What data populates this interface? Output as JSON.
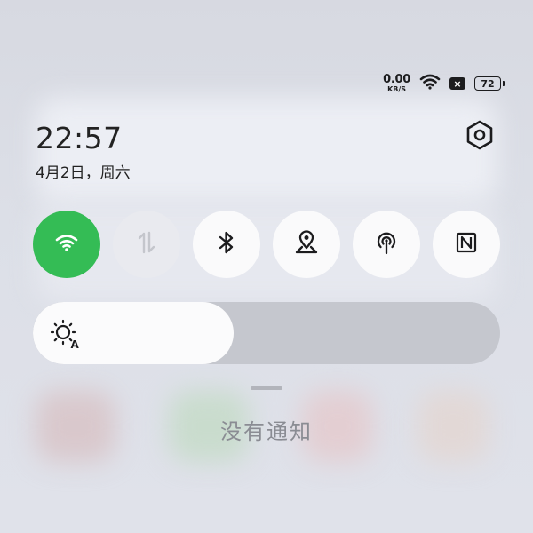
{
  "status_bar": {
    "net_speed_value": "0.00",
    "net_speed_unit": "KB/S",
    "battery_level": "72"
  },
  "header": {
    "time": "22:57",
    "date": "4月2日，周六"
  },
  "quick_toggles": [
    {
      "name": "wifi",
      "icon": "wifi-icon",
      "state": "on"
    },
    {
      "name": "mobile-data",
      "icon": "data-arrows-icon",
      "state": "unavailable"
    },
    {
      "name": "bluetooth",
      "icon": "bluetooth-icon",
      "state": "off"
    },
    {
      "name": "location",
      "icon": "location-pin-icon",
      "state": "off"
    },
    {
      "name": "hotspot",
      "icon": "hotspot-icon",
      "state": "off"
    },
    {
      "name": "nfc",
      "icon": "nfc-icon",
      "state": "off"
    }
  ],
  "brightness": {
    "icon": "auto-brightness-icon",
    "level_percent": 43
  },
  "notifications": {
    "empty_text": "没有通知"
  },
  "colors": {
    "accent_on": "#34bc55",
    "tile_off": "#fafafb"
  }
}
